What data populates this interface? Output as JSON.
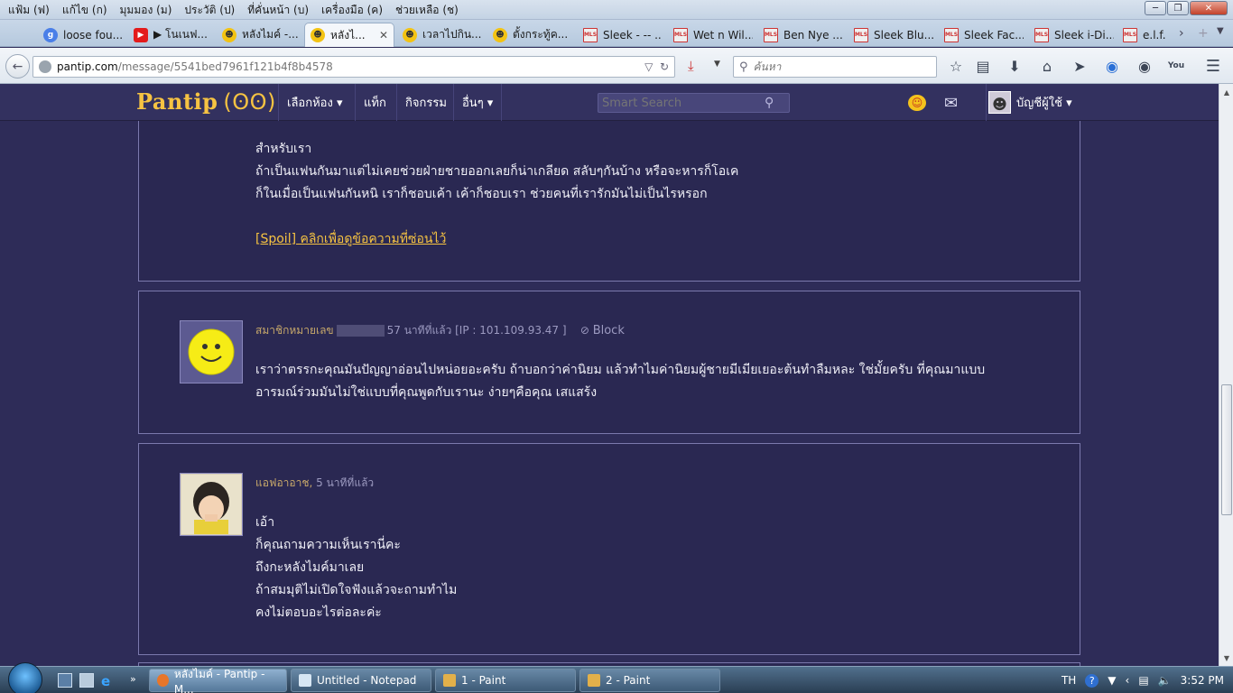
{
  "menubar": {
    "items": [
      "แฟ้ม (ฟ)",
      "แก้ไข (ก)",
      "มุมมอง (ม)",
      "ประวัติ (ป)",
      "ที่คั่นหน้า (บ)",
      "เครื่องมือ (ค)",
      "ช่วยเหลือ (ช)"
    ]
  },
  "tabs": [
    {
      "label": "loose fou...",
      "icon": "google-icon"
    },
    {
      "label": "▶ โนเนฟ...",
      "icon": "youtube-icon"
    },
    {
      "label": "หลังไมค์ -...",
      "icon": "pantip-smile-icon"
    },
    {
      "label": "หลังไ...",
      "icon": "pantip-smile-icon",
      "active": true,
      "close": "✕"
    },
    {
      "label": "เวลาไปกิน...",
      "icon": "pantip-smile-icon"
    },
    {
      "label": "ตั้งกระทู้ค...",
      "icon": "pantip-smile-icon"
    },
    {
      "label": "Sleek - -- ...",
      "icon": "mls-icon"
    },
    {
      "label": "Wet n Wil...",
      "icon": "mls-icon"
    },
    {
      "label": "Ben Nye ...",
      "icon": "mls-icon"
    },
    {
      "label": "Sleek Blu...",
      "icon": "mls-icon"
    },
    {
      "label": "Sleek Fac...",
      "icon": "mls-icon"
    },
    {
      "label": "Sleek i-Di...",
      "icon": "mls-icon"
    },
    {
      "label": "e.l.f. Ey...",
      "icon": "mls-icon"
    }
  ],
  "nav": {
    "url_host": "pantip.com",
    "url_path": "/message/5541bed7961f121b4f8b4578",
    "search_placeholder": "ค้นหา"
  },
  "site": {
    "logo_text": "Pantip",
    "logo_mark": "(ʘʘ)",
    "nav": [
      "เลือกห้อง ▾",
      "แท็ก",
      "กิจกรรม",
      "อื่นๆ ▾"
    ],
    "search_placeholder": "Smart Search",
    "account_label": "บัญชีผู้ใช้ ▾"
  },
  "messages": [
    {
      "lines": [
        "สำหรับเรา",
        "ถ้าเป็นแฟนกันมาแต่ไม่เคยช่วยฝ่ายชายออกเลยก็น่าเกลียด สลับๆกันบ้าง หรือจะหารก็โอเค",
        "ก็ในเมื่อเป็นแฟนกันหนิ เราก็ชอบเค้า เค้าก็ชอบเรา ช่วยคนที่เรารักมันไม่เป็นไรหรอก"
      ],
      "spoil": "[Spoil] คลิกเพื่อดูข้อความที่ซ่อนไว้"
    },
    {
      "author": "สมาชิกหมายเลข",
      "time": "57 นาทีที่แล้ว [IP : 101.109.93.47 ]",
      "block": "Block",
      "lines": [
        "เราว่าตรรกะคุณมันปัญญาอ่อนไปหน่อยอะครับ ถ้าบอกว่าค่านิยม แล้วทำไมค่านิยมผู้ชายมีเมียเยอะต้นทำลืมหละ ใช่มั้ยครับ ที่คุณมาแบบ",
        "อารมณ์ร่วมมันไม่ใช่แบบที่คุณพูดกับเรานะ ง่ายๆคือคุณ เสแสร้ง"
      ]
    },
    {
      "author": "แอฟอาอาช,",
      "time": "5 นาทีที่แล้ว",
      "lines": [
        "เอ้า",
        "ก็คุณถามความเห็นเรานี่คะ",
        "ถึงกะหลังไมค์มาเลย",
        "ถ้าสมมุติไม่เปิดใจฟังแล้วจะถามทำไม",
        "คงไม่ตอบอะไรต่อละค่ะ"
      ]
    }
  ],
  "taskbar": {
    "tasks": [
      "หลังไมค์ - Pantip - M...",
      "Untitled - Notepad",
      "1 - Paint",
      "2 - Paint"
    ],
    "lang": "TH",
    "time": "3:52 PM"
  },
  "colors": {
    "accent": "#f6c342",
    "bg": "#2e2c58",
    "card": "#2a2852",
    "meta": "#c7a86a"
  }
}
